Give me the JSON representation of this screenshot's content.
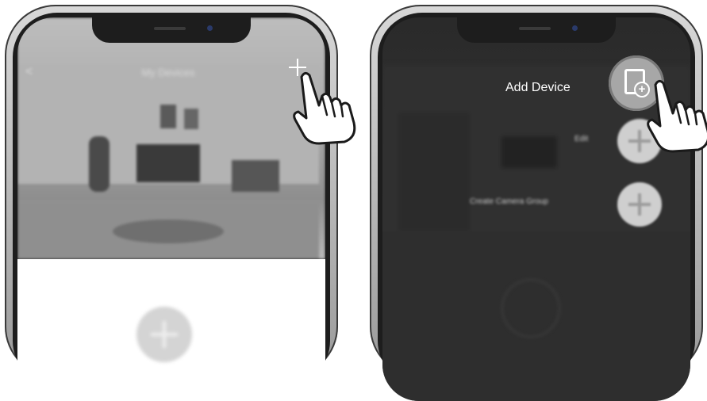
{
  "left_screen": {
    "title": "My Devices",
    "back_label": "<",
    "add_button": "+"
  },
  "right_screen": {
    "fab_label": "Add Device",
    "menu_items": [
      {
        "label": "Edit"
      },
      {
        "label": "Create Camera Group"
      }
    ]
  },
  "colors": {
    "frame": "#9a9a9a",
    "bezel": "#1d1d1d",
    "overlay_dark": "#2e2e2e",
    "fab_gray": "#a7a7a7",
    "hand_fill": "#ffffff",
    "hand_stroke": "#1a1a1a"
  }
}
